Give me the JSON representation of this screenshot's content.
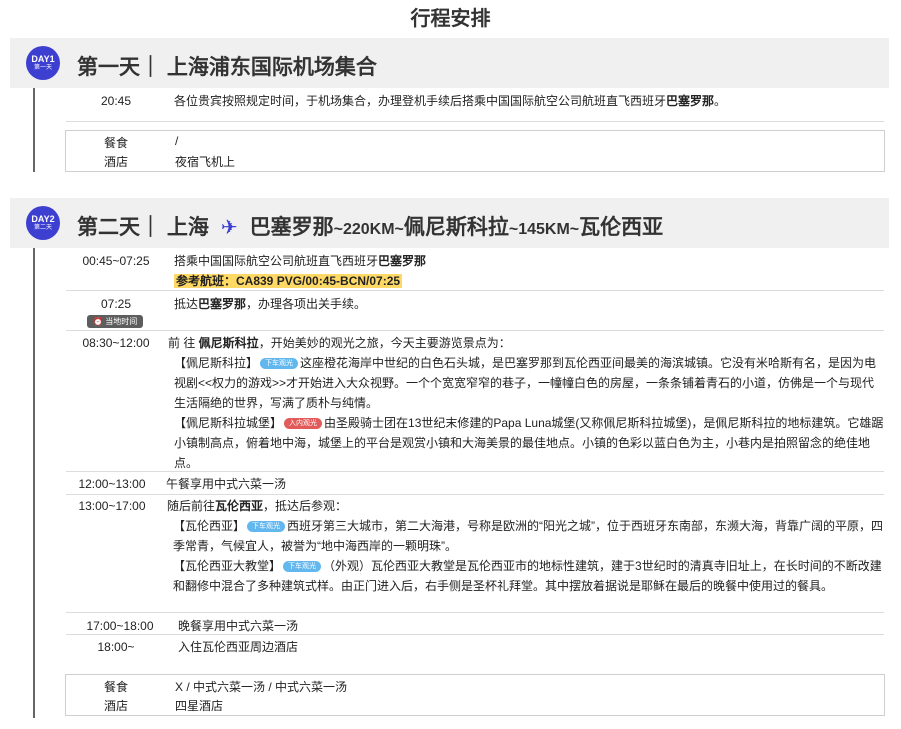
{
  "page_title": "行程安排",
  "day1": {
    "badge_top": "DAY1",
    "badge_bottom": "第一天",
    "header": "第一天｜  上海浦东国际机场集合",
    "items": [
      {
        "time": "20:45",
        "text": "各位贵宾按照规定时间，于机场集合，办理登机手续后搭乘中国国际航空公司航班直飞西班牙",
        "bold": "巴塞罗那",
        "tail": "。"
      }
    ],
    "meal_label": "餐食",
    "meal_value": "/",
    "hotel_label": "酒店",
    "hotel_value": "夜宿飞机上"
  },
  "day2": {
    "badge_top": "DAY2",
    "badge_bottom": "第二天",
    "header_prefix": "第二天｜  上海",
    "header_bcn": "巴塞罗那",
    "header_km1": "~220KM~",
    "header_psk": "佩尼斯科拉",
    "header_km2": "~145KM~",
    "header_vlc": "瓦伦西亚",
    "i1_time": "00:45~07:25",
    "i1_text": "搭乘中国国际航空公司航班直飞西班牙",
    "i1_bold": "巴塞罗那",
    "i1_flight": "参考航班：CA839   PVG/00:45-BCN/07:25",
    "i2_time": "07:25",
    "i2_badge": "当地时间",
    "i2_pre": "抵达",
    "i2_bold": "巴塞罗那",
    "i2_post": "，办理各项出关手续。",
    "i3_time": "08:30~12:00",
    "i3_intro_pre": "前 往 ",
    "i3_intro_bold": "佩尼斯科拉",
    "i3_intro_post": "，开始美妙的观光之旅，今天主要游览景点为：",
    "i3_a_name": "【佩尼斯科拉】",
    "i3_a_tag": "下车观光",
    "i3_a_text": "这座橙花海岸中世纪的白色石头城，是巴塞罗那到瓦伦西亚间最美的海滨城镇。它没有米哈斯有名，是因为电视剧<<权力的游戏>>才开始进入大众视野。一个个宽宽窄窄的巷子，一幢幢白色的房屋，一条条铺着青石的小道，仿佛是一个与现代生活隔绝的世界，写满了质朴与纯情。",
    "i3_b_name": "【佩尼斯科拉城堡】",
    "i3_b_tag": "入内观光",
    "i3_b_text": "由圣殿骑士团在13世纪末修建的Papa  Luna城堡(又称佩尼斯科拉城堡)，是佩尼斯科拉的地标建筑。它雄踞小镇制高点，俯着地中海，城堡上的平台是观赏小镇和大海美景的最佳地点。小镇的色彩以蓝白色为主，小巷内是拍照留念的绝佳地点。",
    "i4_time": "12:00~13:00",
    "i4_text": "午餐享用中式六菜一汤",
    "i5_time": "13:00~17:00",
    "i5_intro_pre": "随后前往",
    "i5_intro_bold": "瓦伦西亚",
    "i5_intro_post": "，抵达后参观：",
    "i5_a_name": "【瓦伦西亚】",
    "i5_a_tag": "下车观光",
    "i5_a_text": "西班牙第三大城市，第二大海港，号称是欧洲的“阳光之城”，位于西班牙东南部，东濒大海，背靠广阔的平原，四季常青，气候宜人，被誉为“地中海西岸的一颗明珠”。",
    "i5_b_name": "【瓦伦西亚大教堂】",
    "i5_b_tag": "下车观光",
    "i5_b_text": "（外观）瓦伦西亚大教堂是瓦伦西亚市的地标性建筑，建于3世纪时的清真寺旧址上，在长时间的不断改建和翻修中混合了多种建筑式样。由正门进入后，右手侧是圣杯礼拜堂。其中摆放着据说是耶稣在最后的晚餐中使用过的餐具。",
    "i6_time": "17:00~18:00",
    "i6_text": "晚餐享用中式六菜一汤",
    "i7_time": "18:00~",
    "i7_text": "入住瓦伦西亚周边酒店",
    "meal_label": "餐食",
    "meal_value": "X / 中式六菜一汤 / 中式六菜一汤",
    "hotel_label": "酒店",
    "hotel_value": "四星酒店"
  },
  "icons": {
    "plane": "airplane-icon",
    "clock": "clock-icon"
  },
  "colors": {
    "accent": "#3d3fd1",
    "highlight": "#ffd966",
    "tag_blue": "#62b7ef",
    "tag_red": "#e25a5a",
    "header_bg": "#f0f0f0"
  }
}
